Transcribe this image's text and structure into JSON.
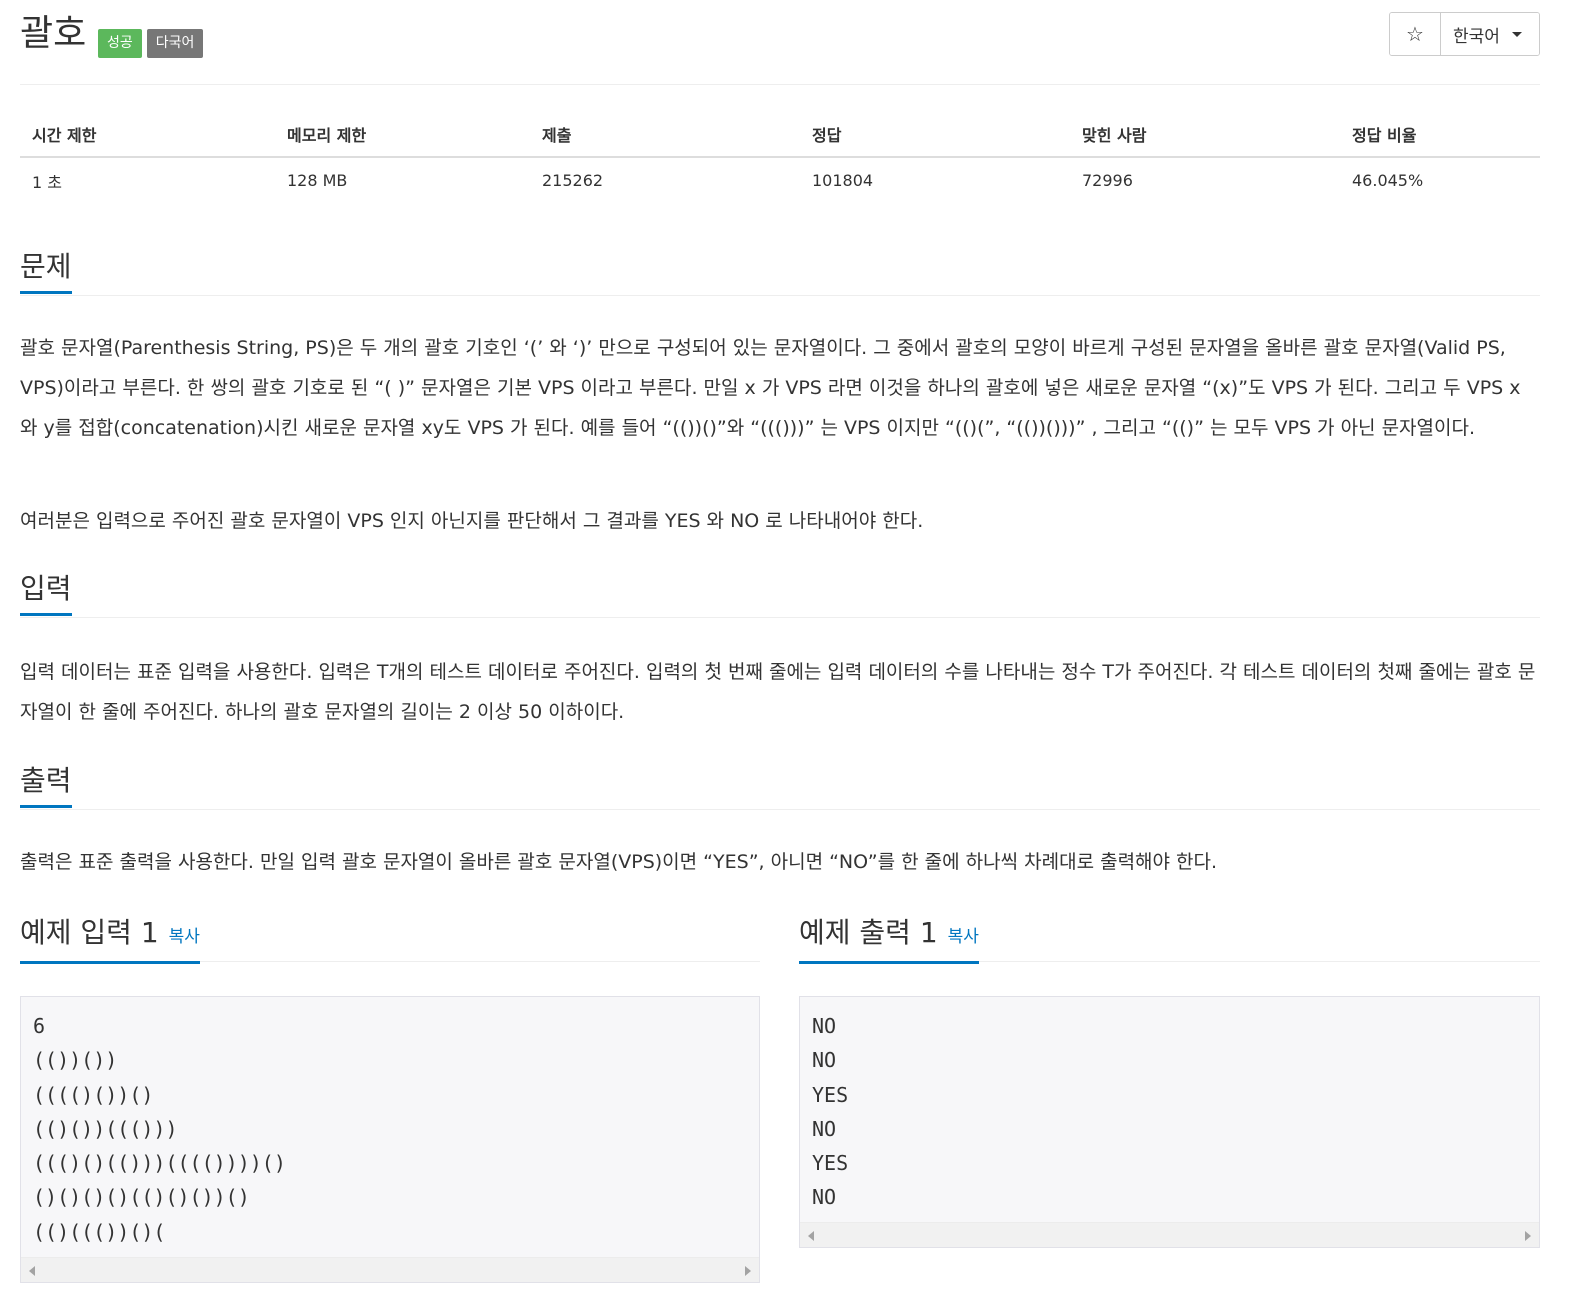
{
  "problem": {
    "title": "괄호",
    "labels": {
      "success": "성공",
      "multilang": "다국어"
    }
  },
  "header_buttons": {
    "star_icon": "☆",
    "language": "한국어"
  },
  "info_table": {
    "headers": [
      "시간 제한",
      "메모리 제한",
      "제출",
      "정답",
      "맞힌 사람",
      "정답 비율"
    ],
    "values": [
      "1 초",
      "128 MB",
      "215262",
      "101804",
      "72996",
      "46.045%"
    ]
  },
  "sections": {
    "description": {
      "title": "문제",
      "paragraphs": [
        "괄호 문자열(Parenthesis String, PS)은 두 개의 괄호 기호인 ‘(’ 와 ‘)’ 만으로 구성되어 있는 문자열이다. 그 중에서 괄호의 모양이 바르게 구성된 문자열을 올바른 괄호 문자열(Valid PS, VPS)이라고 부른다. 한 쌍의 괄호 기호로 된 “( )” 문자열은 기본 VPS 이라고 부른다. 만일 x 가 VPS 라면 이것을 하나의 괄호에 넣은 새로운 문자열 “(x)”도 VPS 가 된다. 그리고 두 VPS x 와 y를 접합(concatenation)시킨 새로운 문자열 xy도 VPS 가 된다. 예를 들어 “(())()”와 “((()))” 는 VPS 이지만 “(()(”, “(())()))” , 그리고 “(()” 는 모두 VPS 가 아닌 문자열이다.",
        "여러분은 입력으로 주어진 괄호 문자열이 VPS 인지 아닌지를 판단해서 그 결과를 YES 와 NO 로 나타내어야 한다."
      ]
    },
    "input": {
      "title": "입력",
      "paragraph": "입력 데이터는 표준 입력을 사용한다. 입력은 T개의 테스트 데이터로 주어진다. 입력의 첫 번째 줄에는 입력 데이터의 수를 나타내는 정수 T가 주어진다. 각 테스트 데이터의 첫째 줄에는 괄호 문자열이 한 줄에 주어진다. 하나의 괄호 문자열의 길이는 2 이상 50 이하이다."
    },
    "output": {
      "title": "출력",
      "paragraph": "출력은 표준 출력을 사용한다. 만일 입력 괄호 문자열이 올바른 괄호 문자열(VPS)이면 “YES”, 아니면 “NO”를 한 줄에 하나씩 차례대로 출력해야 한다."
    }
  },
  "samples": {
    "input": {
      "title": "예제 입력 1",
      "copy_label": "복사",
      "text": "6\n(())())\n(((()())()\n(()())((()))\n((()()(()))(((())))()\n()()()()(()()())()\n(()((())()("
    },
    "output": {
      "title": "예제 출력 1",
      "copy_label": "복사",
      "text": "NO\nNO\nYES\nNO\nYES\nNO"
    }
  }
}
